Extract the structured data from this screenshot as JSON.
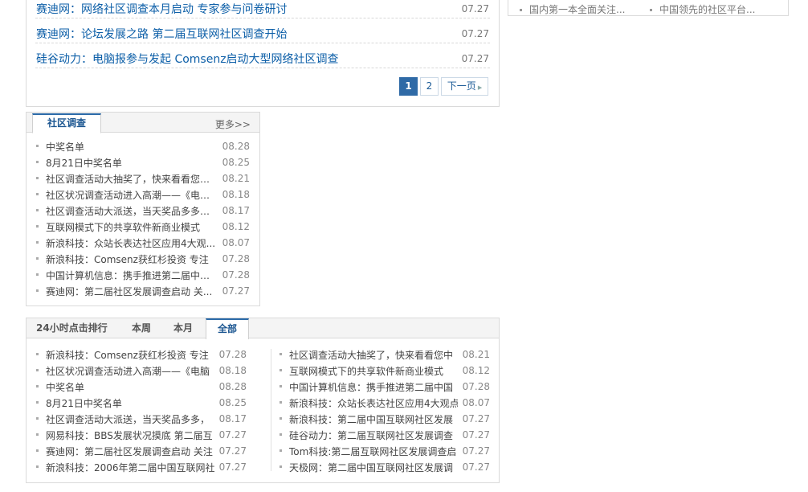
{
  "news": {
    "items": [
      {
        "title": "赛迪网：网络社区调查本月启动  专家参与问卷研讨",
        "date": "07.27"
      },
      {
        "title": "赛迪网：论坛发展之路  第二届互联网社区调查开始",
        "date": "07.27"
      },
      {
        "title": "硅谷动力：电脑报参与发起  Comsenz启动大型网络社区调查",
        "date": "07.27"
      }
    ],
    "pager": {
      "page1": "1",
      "page2": "2",
      "next": "下一页"
    }
  },
  "side": {
    "items": [
      "国内第一本全面关注...",
      "中国领先的社区平台..."
    ]
  },
  "survey": {
    "tab": "社区调查",
    "more": "更多>>",
    "items": [
      {
        "title": "中奖名单",
        "date": "08.28"
      },
      {
        "title": "8月21日中奖名单",
        "date": "08.25"
      },
      {
        "title": "社区调查活动大抽奖了，快来看看您中...",
        "date": "08.21"
      },
      {
        "title": "社区状况调查活动进入高潮——《电脑...",
        "date": "08.18"
      },
      {
        "title": "社区调查活动大派送，当天奖品多多，...",
        "date": "08.17"
      },
      {
        "title": "互联网模式下的共享软件新商业模式",
        "date": "08.12"
      },
      {
        "title": "新浪科技：众站长表达社区应用4大观...",
        "date": "08.07"
      },
      {
        "title": "新浪科技：Comsenz获红杉投资  专注",
        "date": "07.28"
      },
      {
        "title": "中国计算机信息：携手推进第二届中国...",
        "date": "07.28"
      },
      {
        "title": "赛迪网：第二届社区发展调查启动  关...",
        "date": "07.27"
      }
    ]
  },
  "rank": {
    "tabs": [
      "24小时点击排行",
      "本周",
      "本月",
      "全部"
    ],
    "left": [
      {
        "title": "新浪科技：Comsenz获红杉投资  专注",
        "date": "07.28"
      },
      {
        "title": "社区状况调查活动进入高潮——《电脑",
        "date": "08.18"
      },
      {
        "title": "中奖名单",
        "date": "08.28"
      },
      {
        "title": "8月21日中奖名单",
        "date": "08.25"
      },
      {
        "title": "社区调查活动大派送，当天奖品多多，",
        "date": "08.17"
      },
      {
        "title": "网易科技：BBS发展状况摸底  第二届互",
        "date": "07.27"
      },
      {
        "title": "赛迪网：第二届社区发展调查启动  关注",
        "date": "07.27"
      },
      {
        "title": "新浪科技：2006年第二届中国互联网社",
        "date": "07.27"
      }
    ],
    "right": [
      {
        "title": "社区调查活动大抽奖了，快来看看您中",
        "date": "08.21"
      },
      {
        "title": "互联网模式下的共享软件新商业模式",
        "date": "08.12"
      },
      {
        "title": "中国计算机信息：携手推进第二届中国",
        "date": "07.28"
      },
      {
        "title": "新浪科技：众站长表达社区应用4大观点",
        "date": "08.07"
      },
      {
        "title": "新浪科技：第二届中国互联网社区发展",
        "date": "07.27"
      },
      {
        "title": "硅谷动力：第二届互联网社区发展调查",
        "date": "07.27"
      },
      {
        "title": "Tom科技:第二届互联网社区发展调查启",
        "date": "07.27"
      },
      {
        "title": "天极网：第二届中国互联网社区发展调",
        "date": "07.27"
      }
    ]
  }
}
